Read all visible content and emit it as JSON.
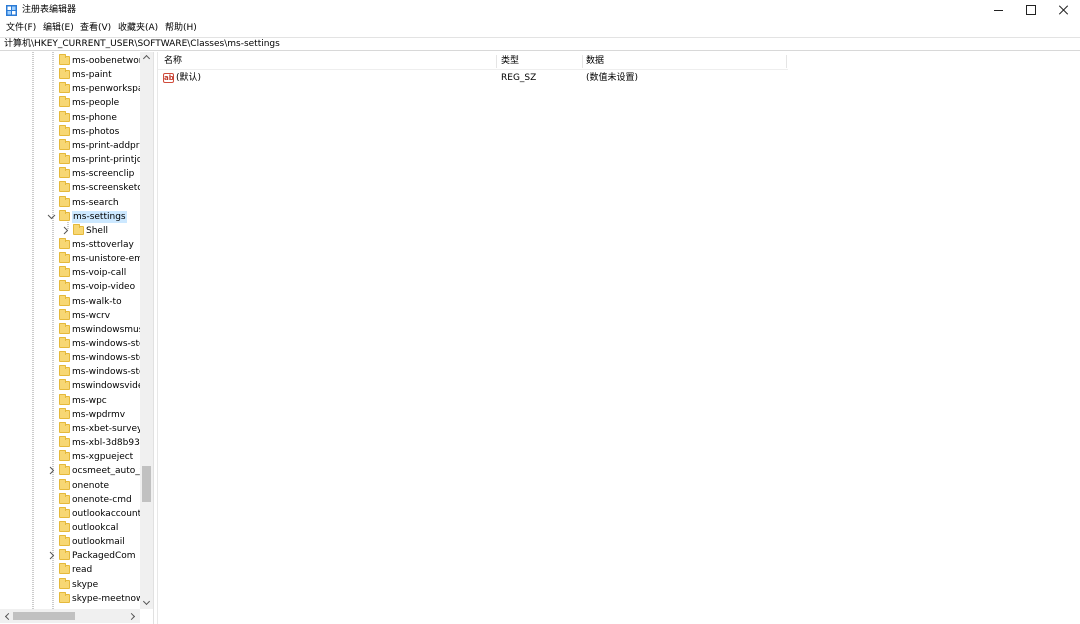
{
  "window": {
    "title": "注册表编辑器",
    "icon": "regedit-icon"
  },
  "menu": [
    "文件(F)",
    "编辑(E)",
    "查看(V)",
    "收藏夹(A)",
    "帮助(H)"
  ],
  "address": "计算机\\HKEY_CURRENT_USER\\SOFTWARE\\Classes\\ms-settings",
  "tree": {
    "selected": "ms-settings",
    "items": [
      {
        "label": "ms-oobenetworl",
        "level": 0,
        "expander": "none"
      },
      {
        "label": "ms-paint",
        "level": 0,
        "expander": "none"
      },
      {
        "label": "ms-penworkspa",
        "level": 0,
        "expander": "none"
      },
      {
        "label": "ms-people",
        "level": 0,
        "expander": "none"
      },
      {
        "label": "ms-phone",
        "level": 0,
        "expander": "none"
      },
      {
        "label": "ms-photos",
        "level": 0,
        "expander": "none"
      },
      {
        "label": "ms-print-addprii",
        "level": 0,
        "expander": "none"
      },
      {
        "label": "ms-print-printjol",
        "level": 0,
        "expander": "none"
      },
      {
        "label": "ms-screenclip",
        "level": 0,
        "expander": "none"
      },
      {
        "label": "ms-screensketch",
        "level": 0,
        "expander": "none"
      },
      {
        "label": "ms-search",
        "level": 0,
        "expander": "none"
      },
      {
        "label": "ms-settings",
        "level": 0,
        "expander": "expanded"
      },
      {
        "label": "Shell",
        "level": 1,
        "expander": "collapsed"
      },
      {
        "label": "ms-sttoverlay",
        "level": 0,
        "expander": "none"
      },
      {
        "label": "ms-unistore-ema",
        "level": 0,
        "expander": "none"
      },
      {
        "label": "ms-voip-call",
        "level": 0,
        "expander": "none"
      },
      {
        "label": "ms-voip-video",
        "level": 0,
        "expander": "none"
      },
      {
        "label": "ms-walk-to",
        "level": 0,
        "expander": "none"
      },
      {
        "label": "ms-wcrv",
        "level": 0,
        "expander": "none"
      },
      {
        "label": "mswindowsmusi",
        "level": 0,
        "expander": "none"
      },
      {
        "label": "ms-windows-sto",
        "level": 0,
        "expander": "none"
      },
      {
        "label": "ms-windows-sto",
        "level": 0,
        "expander": "none"
      },
      {
        "label": "ms-windows-sto",
        "level": 0,
        "expander": "none"
      },
      {
        "label": "mswindowsvideo",
        "level": 0,
        "expander": "none"
      },
      {
        "label": "ms-wpc",
        "level": 0,
        "expander": "none"
      },
      {
        "label": "ms-wpdrmv",
        "level": 0,
        "expander": "none"
      },
      {
        "label": "ms-xbet-survey",
        "level": 0,
        "expander": "none"
      },
      {
        "label": "ms-xbl-3d8b930",
        "level": 0,
        "expander": "none"
      },
      {
        "label": "ms-xgpueject",
        "level": 0,
        "expander": "none"
      },
      {
        "label": "ocsmeet_auto_fil",
        "level": 0,
        "expander": "collapsed"
      },
      {
        "label": "onenote",
        "level": 0,
        "expander": "none"
      },
      {
        "label": "onenote-cmd",
        "level": 0,
        "expander": "none"
      },
      {
        "label": "outlookaccounts",
        "level": 0,
        "expander": "none"
      },
      {
        "label": "outlookcal",
        "level": 0,
        "expander": "none"
      },
      {
        "label": "outlookmail",
        "level": 0,
        "expander": "none"
      },
      {
        "label": "PackagedCom",
        "level": 0,
        "expander": "collapsed"
      },
      {
        "label": "read",
        "level": 0,
        "expander": "none"
      },
      {
        "label": "skype",
        "level": 0,
        "expander": "none"
      },
      {
        "label": "skype-meetnow",
        "level": 0,
        "expander": "none"
      }
    ]
  },
  "list": {
    "columns": [
      "名称",
      "类型",
      "数据"
    ],
    "rows": [
      {
        "name": "(默认)",
        "type": "REG_SZ",
        "data": "(数值未设置)",
        "icon": "string-value-icon"
      }
    ]
  },
  "colors": {
    "selection": "#cce8ff",
    "folder": "#f7d774"
  }
}
